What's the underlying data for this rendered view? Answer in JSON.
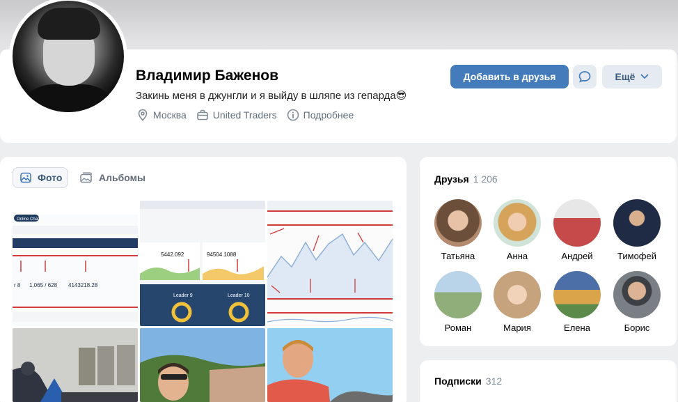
{
  "profile": {
    "name": "Владимир Баженов",
    "status": "Закинь меня в джунгли и я выйду в шляпе из гепарда😎",
    "city": "Москва",
    "work": "United Traders",
    "more_info": "Подробнее"
  },
  "actions": {
    "add_friend": "Добавить в друзья",
    "more": "Ещё"
  },
  "photos": {
    "tab_photo": "Фото",
    "tab_albums": "Альбомы",
    "tile_texts": {
      "t1_label1": "Online Chat",
      "t1_value1": "1,065 / 628",
      "t1_value2": "4143218.28",
      "t2_value1": "5442.092",
      "t2_value2": "94504.1088",
      "t2_leader1": "Leader 9",
      "t2_leader2": "Leader 10"
    }
  },
  "friends": {
    "title": "Друзья",
    "count": "1 206",
    "items": [
      {
        "name": "Татьяна",
        "color": "#b48a6e"
      },
      {
        "name": "Анна",
        "color": "#d9b77a"
      },
      {
        "name": "Андрей",
        "color": "#c74a4a"
      },
      {
        "name": "Тимофей",
        "color": "#1f2a44"
      },
      {
        "name": "Роман",
        "color": "#8fae7a"
      },
      {
        "name": "Мария",
        "color": "#c6a37c"
      },
      {
        "name": "Елена",
        "color": "#4d6fa8"
      },
      {
        "name": "Борис",
        "color": "#7a7f86"
      }
    ]
  },
  "subscriptions": {
    "title": "Подписки",
    "count": "312"
  },
  "colors": {
    "accent": "#447bba",
    "secondary_btn": "#e5ebf1",
    "muted_text": "#626d7a"
  }
}
